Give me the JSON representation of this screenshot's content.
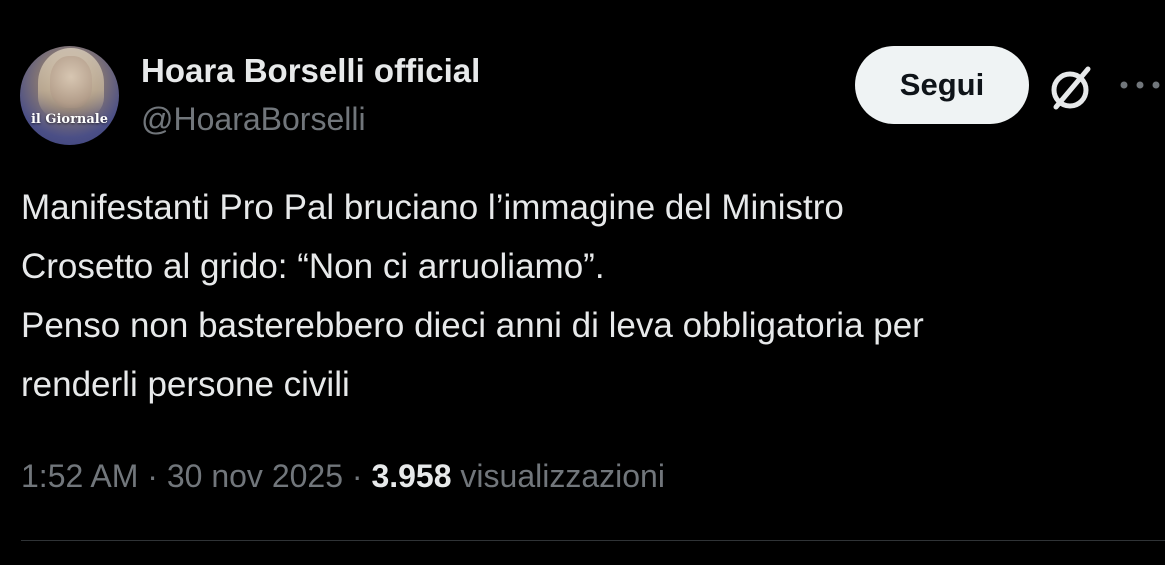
{
  "author": {
    "display_name": "Hoara Borselli official",
    "handle": "@HoaraBorselli",
    "avatar_logo_text": "il Giornale"
  },
  "actions": {
    "follow_label": "Segui",
    "grok_icon": "grok-slash-circle-icon",
    "more_icon": "more-horizontal-icon"
  },
  "tweet": {
    "text": "Manifestanti Pro Pal bruciano l’immagine del Ministro\nCrosetto al grido: “Non ci arruoliamo”.\nPenso non basterebbero dieci anni di leva obbligatoria per\nrenderli persone civili"
  },
  "meta": {
    "time": "1:52 AM",
    "separator1": " · ",
    "date": "30 nov 2025",
    "separator2": " · ",
    "views_count": "3.958",
    "views_label": " visualizzazioni"
  },
  "colors": {
    "background": "#000000",
    "primary_text": "#e7e9ea",
    "secondary_text": "#71767b",
    "button_bg": "#eff3f4",
    "button_text": "#0f1419",
    "divider": "#2f3336"
  }
}
